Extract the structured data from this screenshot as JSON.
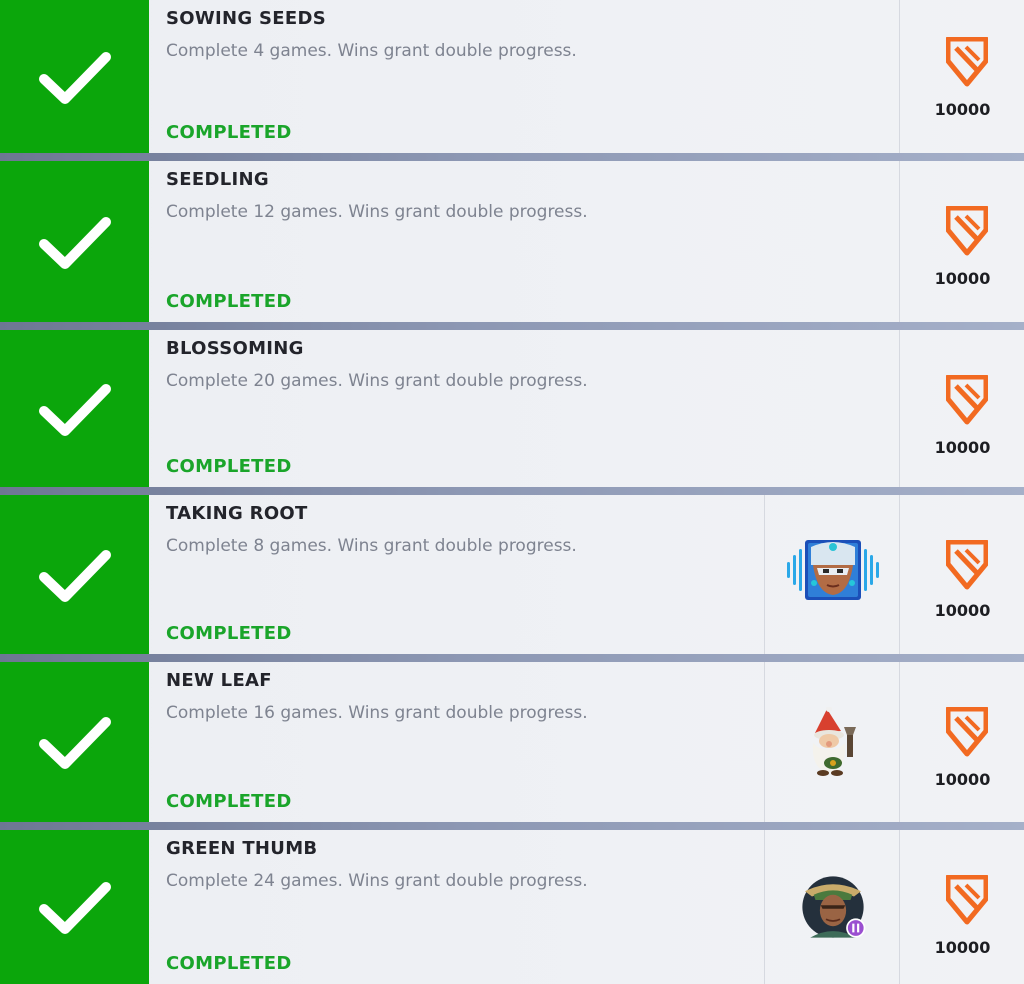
{
  "challenges": [
    {
      "title": "SOWING SEEDS",
      "description": "Complete 4 games. Wins grant double progress.",
      "status": "COMPLETED",
      "reward_value": "10000",
      "reward_icon": "shield-currency-icon",
      "item": null
    },
    {
      "title": "SEEDLING",
      "description": "Complete 12 games. Wins grant double progress.",
      "status": "COMPLETED",
      "reward_value": "10000",
      "reward_icon": "shield-currency-icon",
      "item": null
    },
    {
      "title": "BLOSSOMING",
      "description": "Complete 20 games. Wins grant double progress.",
      "status": "COMPLETED",
      "reward_value": "10000",
      "reward_icon": "shield-currency-icon",
      "item": null
    },
    {
      "title": "TAKING ROOT",
      "description": "Complete 8 games. Wins grant double progress.",
      "status": "COMPLETED",
      "reward_value": "10000",
      "reward_icon": "shield-currency-icon",
      "item": "voice-line-icon"
    },
    {
      "title": "NEW LEAF",
      "description": "Complete 16 games. Wins grant double progress.",
      "status": "COMPLETED",
      "reward_value": "10000",
      "reward_icon": "shield-currency-icon",
      "item": "gnome-spray-icon"
    },
    {
      "title": "GREEN THUMB",
      "description": "Complete 24 games. Wins grant double progress.",
      "status": "COMPLETED",
      "reward_value": "10000",
      "reward_icon": "shield-currency-icon",
      "item": "player-icon-portrait"
    }
  ],
  "colors": {
    "complete_green": "#0ba60b",
    "status_text_green": "#1aa52a",
    "currency_orange": "#f26a21",
    "card_bg": "#eef0f3"
  },
  "icons": {
    "check": "check-icon",
    "currency": "shield-currency-icon"
  }
}
